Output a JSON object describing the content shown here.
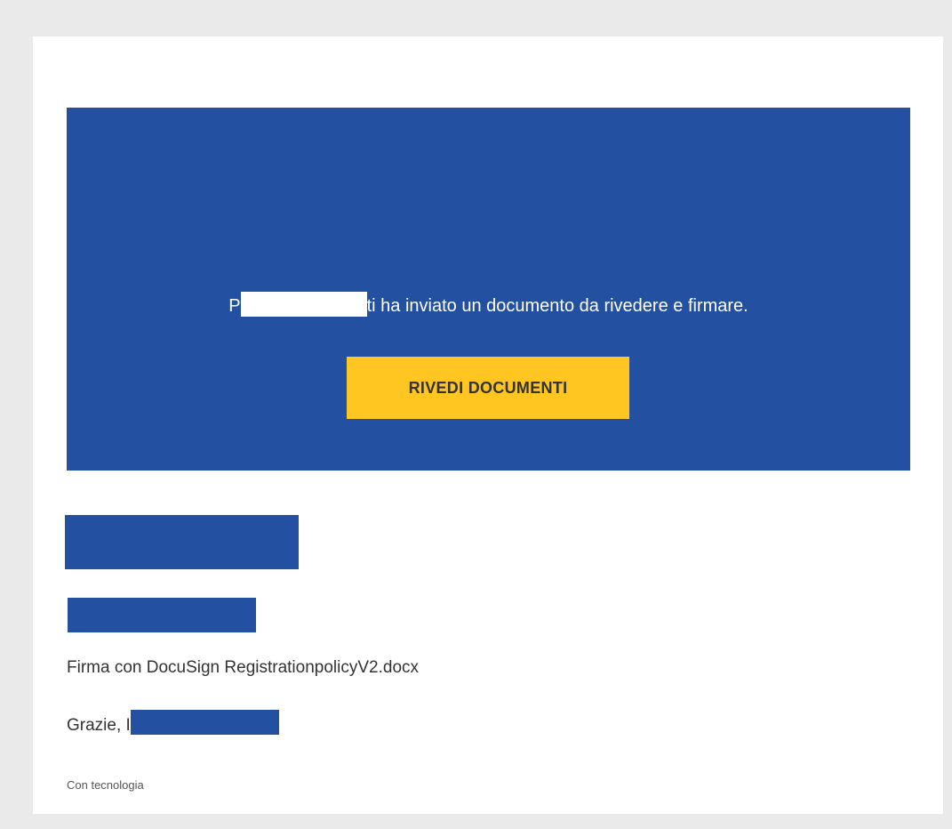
{
  "hero": {
    "sender_initial": "P",
    "message": "ti ha inviato un documento da rivedere e firmare.",
    "button_label": "RIVEDI DOCUMENTI"
  },
  "body": {
    "file_line": "Firma con DocuSign RegistrationpolicyV2.docx",
    "thanks_prefix": "Grazie,",
    "thanks_initial": "I"
  },
  "footer": {
    "powered_by": "Con tecnologia"
  },
  "colors": {
    "hero_background": "#2350a0",
    "button_background": "#ffc520",
    "page_background": "#eaeaea",
    "redaction": "#2350a0"
  }
}
